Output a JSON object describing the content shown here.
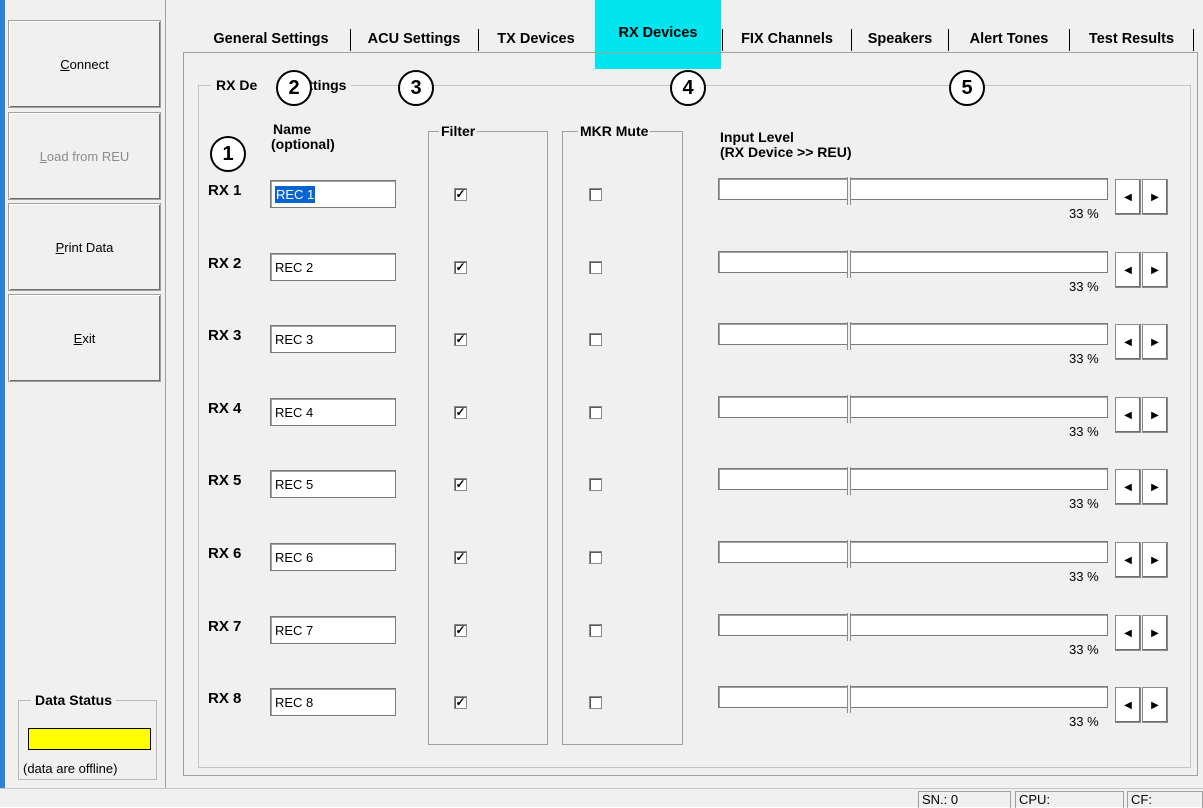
{
  "sidebar": {
    "buttons": [
      {
        "label": "Connect",
        "accel": "C",
        "rest": "onnect",
        "enabled": true
      },
      {
        "label": "Load from REU",
        "accel": "L",
        "rest": "oad from REU",
        "enabled": false
      },
      {
        "label": "Print Data",
        "accel": "P",
        "rest": "rint Data",
        "enabled": true
      },
      {
        "label": "Exit",
        "accel": "E",
        "rest": "xit",
        "enabled": true
      }
    ],
    "data_status": {
      "title": "Data Status",
      "note": "(data are offline)",
      "color": "#ffff00"
    }
  },
  "tabs": [
    {
      "label": "General Settings",
      "active": false
    },
    {
      "label": "ACU Settings",
      "active": false
    },
    {
      "label": "TX Devices",
      "active": false
    },
    {
      "label": "RX Devices",
      "active": true,
      "highlight": "#00e5ee"
    },
    {
      "label": "FIX Channels",
      "active": false
    },
    {
      "label": "Speakers",
      "active": false
    },
    {
      "label": "Alert Tones",
      "active": false
    },
    {
      "label": "Test Results",
      "active": false
    }
  ],
  "group": {
    "title": "RX Device Settings",
    "title_visible": "RX De",
    "title_tail": "Settings",
    "headers": {
      "name_line1": "Name",
      "name_line2": "(optional)",
      "filter": "Filter",
      "mkr_mute": "MKR Mute",
      "input_level_line1": "Input Level",
      "input_level_line2": "(RX Device >> REU)"
    }
  },
  "rows": [
    {
      "label": "RX 1",
      "name": "REC 1",
      "filter": true,
      "mkr_mute": false,
      "level_pct": 33,
      "level_text": "33 %"
    },
    {
      "label": "RX 2",
      "name": "REC 2",
      "filter": true,
      "mkr_mute": false,
      "level_pct": 33,
      "level_text": "33 %"
    },
    {
      "label": "RX 3",
      "name": "REC 3",
      "filter": true,
      "mkr_mute": false,
      "level_pct": 33,
      "level_text": "33 %"
    },
    {
      "label": "RX 4",
      "name": "REC 4",
      "filter": true,
      "mkr_mute": false,
      "level_pct": 33,
      "level_text": "33 %"
    },
    {
      "label": "RX 5",
      "name": "REC 5",
      "filter": true,
      "mkr_mute": false,
      "level_pct": 33,
      "level_text": "33 %"
    },
    {
      "label": "RX 6",
      "name": "REC 6",
      "filter": true,
      "mkr_mute": false,
      "level_pct": 33,
      "level_text": "33 %"
    },
    {
      "label": "RX 7",
      "name": "REC 7",
      "filter": true,
      "mkr_mute": false,
      "level_pct": 33,
      "level_text": "33 %"
    },
    {
      "label": "RX 8",
      "name": "REC 8",
      "filter": true,
      "mkr_mute": false,
      "level_pct": 33,
      "level_text": "33 %"
    }
  ],
  "icons": {
    "check": "✓",
    "arrow_left": "◀",
    "arrow_right": "▶"
  },
  "callouts": [
    "1",
    "2",
    "3",
    "4",
    "5"
  ],
  "statusbar": {
    "sn": "SN.: 0",
    "cpu": "CPU:",
    "cf": "CF:"
  }
}
